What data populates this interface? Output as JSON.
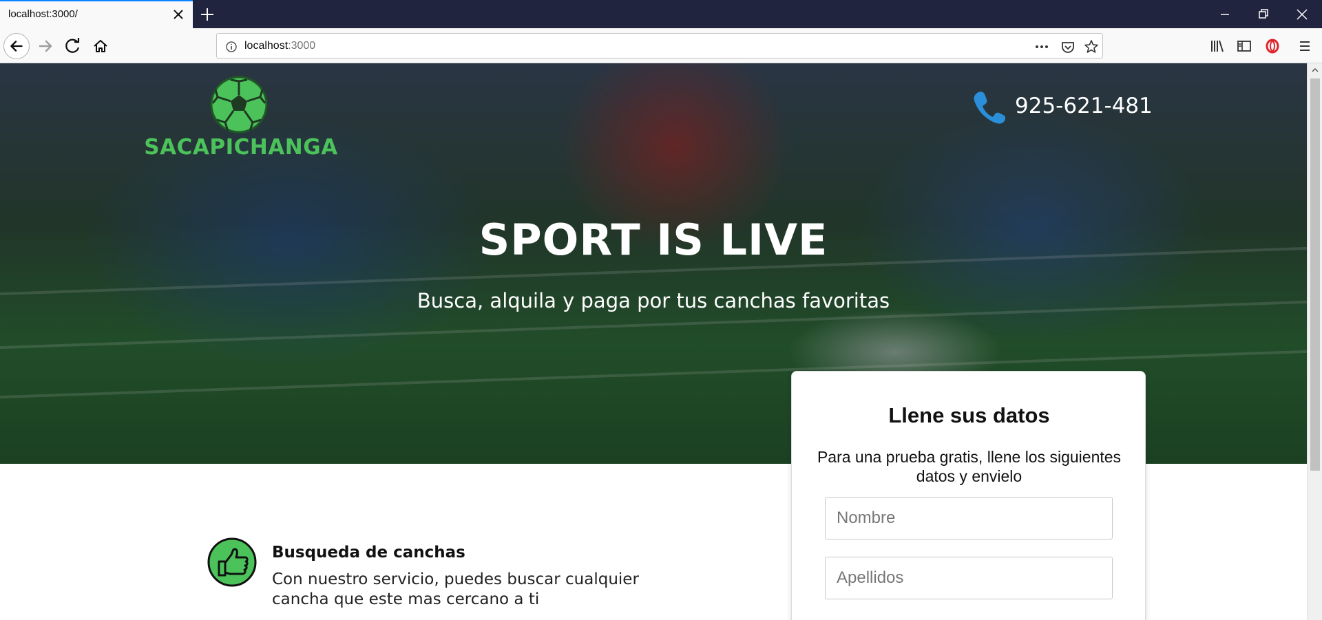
{
  "browser": {
    "tab_title": "localhost:3000/",
    "url_host": "localhost",
    "url_port": ":3000"
  },
  "header": {
    "logo_text": "SACAPICHANGA",
    "phone": "925-621-481"
  },
  "hero": {
    "title": "SPORT IS LIVE",
    "subtitle": "Busca, alquila y paga por tus canchas favoritas"
  },
  "form": {
    "title": "Llene sus datos",
    "description": "Para una prueba gratis, llene los siguientes datos y envielo",
    "nombre_placeholder": "Nombre",
    "apellidos_placeholder": "Apellidos"
  },
  "features": [
    {
      "title": "Busqueda de canchas",
      "text": "Con nuestro servicio, puedes buscar cualquier cancha que este mas cercano a ti",
      "icon": "thumbs-up-icon"
    }
  ],
  "colors": {
    "brand_green": "#4cc35a",
    "phone_blue": "#2a8fd8",
    "tabbar": "#20243f"
  }
}
